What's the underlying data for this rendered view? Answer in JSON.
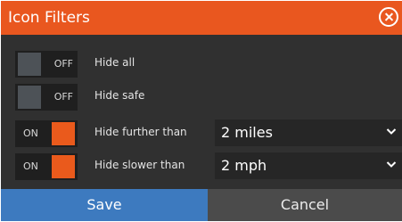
{
  "dialog": {
    "title": "Icon Filters",
    "close_icon": "close-circle-icon"
  },
  "filters": [
    {
      "state_label": "OFF",
      "on": false,
      "label": "Hide all"
    },
    {
      "state_label": "OFF",
      "on": false,
      "label": "Hide safe"
    },
    {
      "state_label": "ON",
      "on": true,
      "label": "Hide further than",
      "select_value": "2 miles"
    },
    {
      "state_label": "ON",
      "on": true,
      "label": "Hide slower than",
      "select_value": "2 mph"
    }
  ],
  "buttons": {
    "save": "Save",
    "cancel": "Cancel"
  },
  "colors": {
    "title_bar": "#e9571f",
    "toggle_on": "#ea5a1c",
    "save_button": "#3d7abf",
    "background": "#303030"
  }
}
